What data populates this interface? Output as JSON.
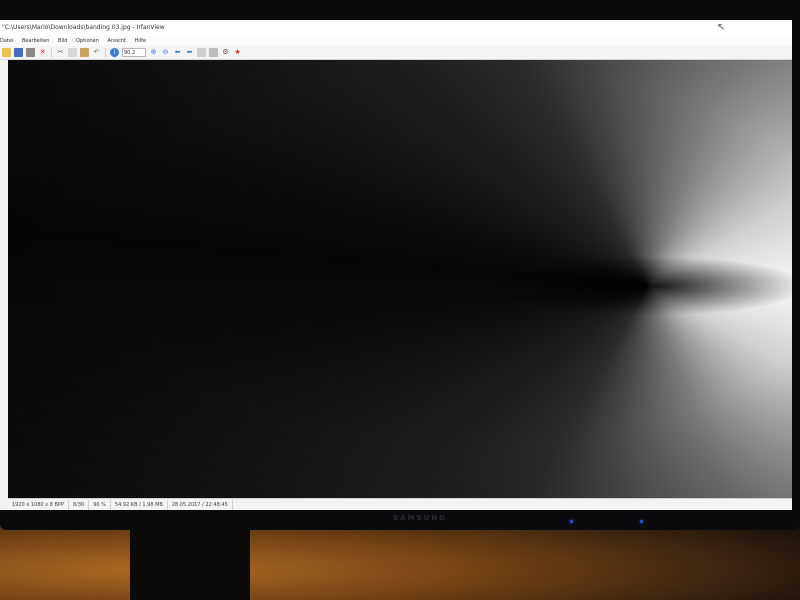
{
  "window": {
    "title": "\"C:\\Users\\Mario\\Downloads\\banding 03.jpg - IrfanView"
  },
  "menu": [
    "Datei",
    "Bearbeiten",
    "Bild",
    "Optionen",
    "Ansicht",
    "Hilfe"
  ],
  "toolbar": {
    "zoom_value": "90.2",
    "icons": [
      "open-icon",
      "save-icon",
      "print-icon",
      "delete-icon",
      "cut-icon",
      "copy-icon",
      "paste-icon",
      "undo-icon",
      "info-icon",
      "zoom-in-icon",
      "zoom-out-icon",
      "previous-icon",
      "next-icon",
      "thumbnails-icon",
      "slideshow-icon",
      "settings-icon",
      "irfanview-icon"
    ]
  },
  "statusbar": {
    "dimensions": "1920 x 1080 x 8 BPP",
    "index": "8/30",
    "zoom": "90 %",
    "filesize": "54.92 KB / 1.98 MB",
    "datetime": "28.05.2017 / 22:48:45"
  },
  "monitor": {
    "brand": "SAMSUNG"
  },
  "colors": {
    "accent_blue": "#3a7bd5",
    "delete_red": "#d42020"
  }
}
